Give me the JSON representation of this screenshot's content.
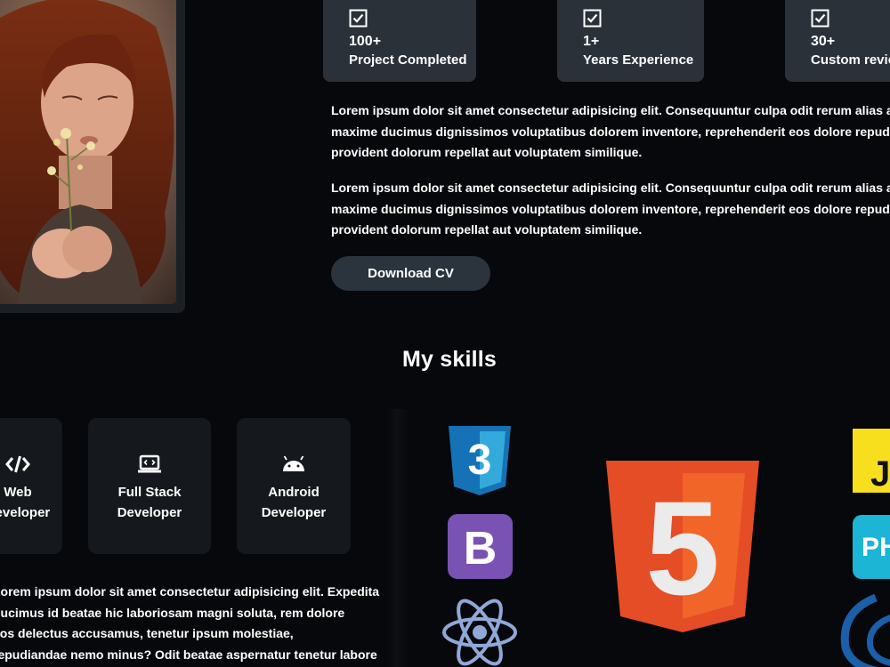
{
  "stats": [
    {
      "value": "100+",
      "label": "Project Completed",
      "icon": "checkbox-icon"
    },
    {
      "value": "1+",
      "label": "Years Experience",
      "icon": "checkbox-icon"
    },
    {
      "value": "30+",
      "label": "Custom reviews",
      "icon": "checkbox-icon"
    }
  ],
  "about": {
    "paragraphs": [
      [
        "Lorem ipsum dolor sit amet consectetur adipisicing elit. Consequuntur culpa odit rerum alias architecto",
        "maxime ducimus dignissimos voluptatibus dolorem inventore, reprehenderit eos dolore repudiandae",
        "provident dolorum repellat aut voluptatem similique."
      ],
      [
        "Lorem ipsum dolor sit amet consectetur adipisicing elit. Consequuntur culpa odit rerum alias architecto",
        "maxime ducimus dignissimos voluptatibus dolorem inventore, reprehenderit eos dolore repudiandae",
        "provident dolorum repellat aut voluptatem similique."
      ]
    ],
    "download_label": "Download CV"
  },
  "skills": {
    "title": "My skills",
    "cards": [
      {
        "icon": "code-icon",
        "lines": [
          "Web",
          "Developer"
        ]
      },
      {
        "icon": "laptop-code-icon",
        "lines": [
          "Full Stack",
          "Developer"
        ]
      },
      {
        "icon": "android-icon",
        "lines": [
          "Android",
          "Developer"
        ]
      }
    ],
    "paragraph": [
      "Lorem ipsum dolor sit amet consectetur adipisicing elit. Expedita",
      "ducimus id beatae hic laboriosam magni soluta, rem dolore",
      "eos delectus accusamus, tenetur ipsum molestiae,",
      "repudiandae nemo minus? Odit beatae aspernatur tenetur labore"
    ],
    "logos": {
      "css": {
        "label": "3",
        "color": "#1572b6"
      },
      "bootstrap": {
        "label": "B",
        "color": "#7952b3"
      },
      "react": {
        "color": "#8fa8d8"
      },
      "html": {
        "label": "5",
        "color": "#e44d26"
      },
      "js": {
        "label": "JS",
        "color": "#f7df1e"
      },
      "php": {
        "label": "PHP",
        "color": "#1cb5d6"
      },
      "jquery": {
        "color": "#1b5fa8"
      }
    }
  },
  "colors": {
    "background": "#06080b",
    "stat_card": "#2a3139",
    "skill_card": "#15191d",
    "button": "#2b333c"
  }
}
